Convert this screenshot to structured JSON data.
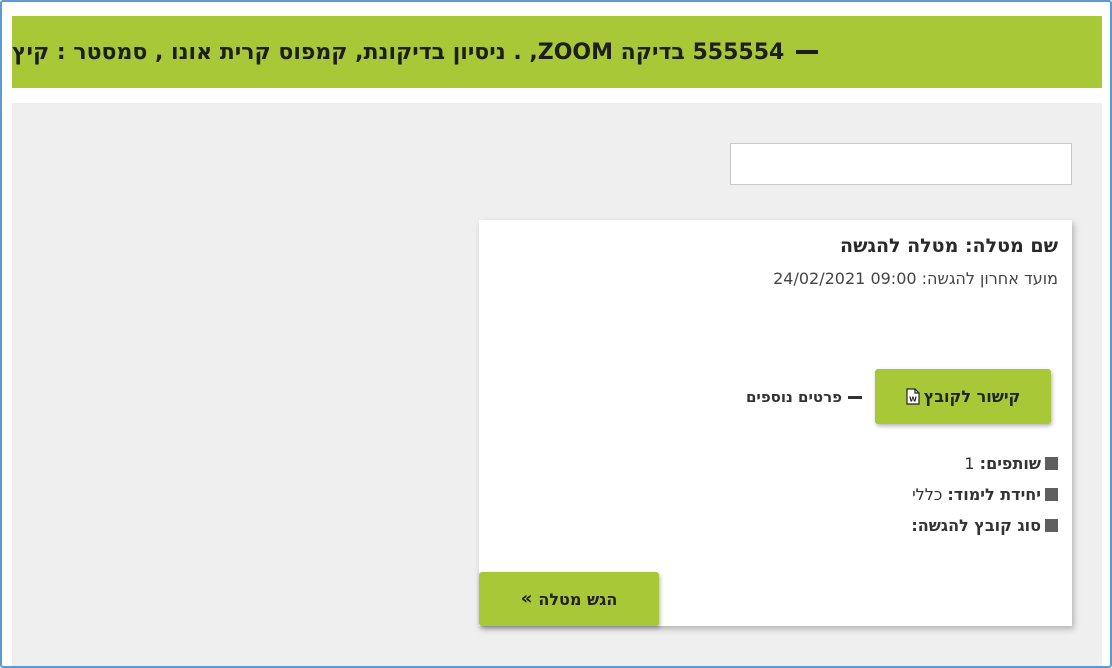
{
  "header": {
    "title": "555554 בדיקה ZOOM, . ניסיון בדיקונת, קמפוס קרית אונו  , סמסטר : קיץ"
  },
  "search": {
    "value": "",
    "placeholder": ""
  },
  "task": {
    "name": "שם מטלה: מטלה להגשה",
    "deadline": "מועד אחרון להגשה: 09:00 24/02/2021",
    "file_link_label": "קישור לקובץ",
    "more_details_label": "פרטים נוספים",
    "details": [
      {
        "label": "שותפים:",
        "value": "1"
      },
      {
        "label": "יחידת לימוד:",
        "value": "כללי"
      },
      {
        "label": "סוג קובץ להגשה:",
        "value": ""
      }
    ],
    "submit_label": "הגש מטלה",
    "submit_icon": "»"
  },
  "colors": {
    "accent": "#a8c837",
    "background": "#efefef",
    "frame_border": "#5b9bd5"
  }
}
